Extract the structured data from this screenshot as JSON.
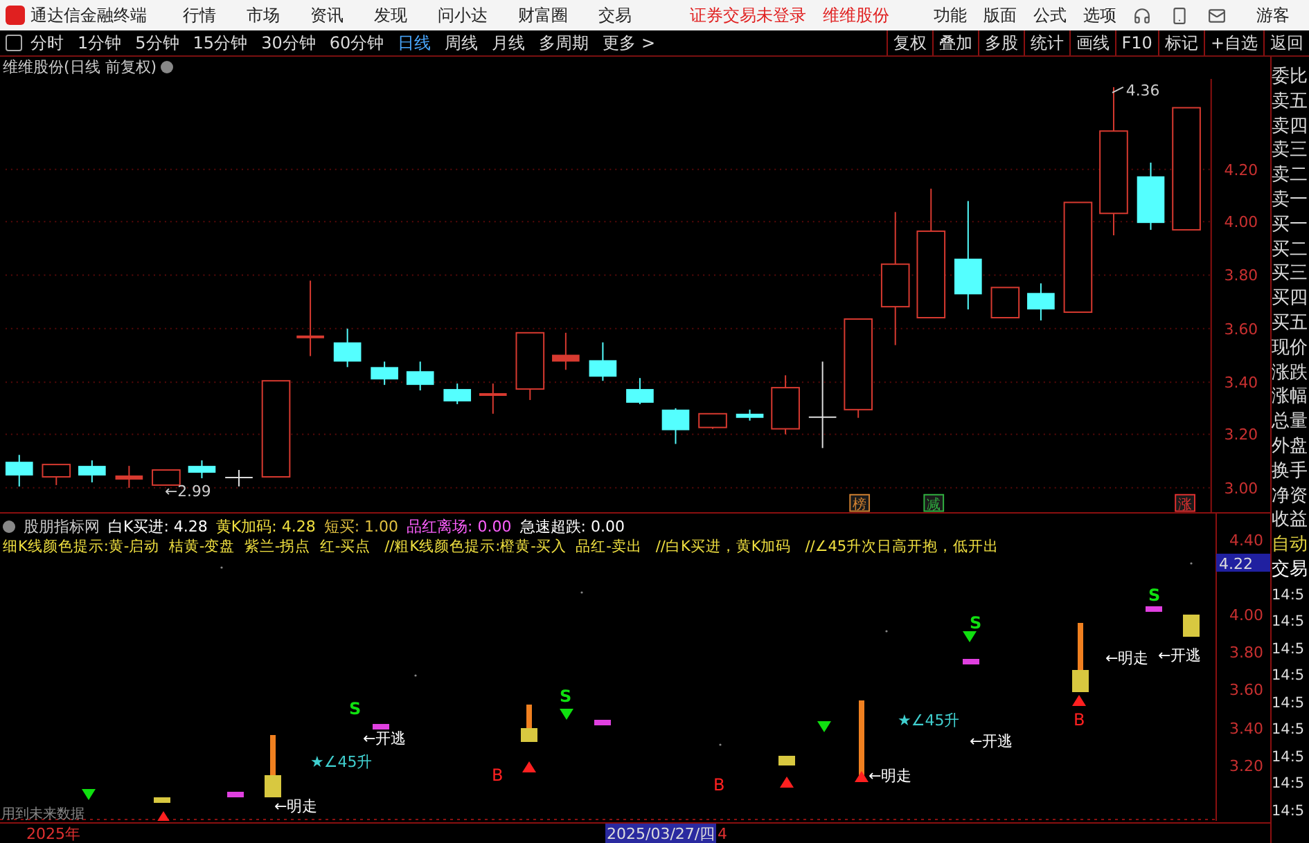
{
  "menu_bar": {
    "app_title": "通达信金融终端",
    "menus": [
      "行情",
      "市场",
      "资讯",
      "发现",
      "问小达",
      "财富圈",
      "交易"
    ],
    "status_notice": "证券交易未登录",
    "stock_name": "维维股份",
    "tools": [
      "功能",
      "版面",
      "公式",
      "选项"
    ],
    "user": "游客"
  },
  "period_bar": {
    "periods": [
      {
        "label": "分时",
        "selected": false
      },
      {
        "label": "1分钟",
        "selected": false
      },
      {
        "label": "5分钟",
        "selected": false
      },
      {
        "label": "15分钟",
        "selected": false
      },
      {
        "label": "30分钟",
        "selected": false
      },
      {
        "label": "60分钟",
        "selected": false
      },
      {
        "label": "日线",
        "selected": true
      },
      {
        "label": "周线",
        "selected": false
      },
      {
        "label": "月线",
        "selected": false
      },
      {
        "label": "多周期",
        "selected": false
      },
      {
        "label": "更多 >",
        "selected": false
      }
    ],
    "actions": [
      "复权",
      "叠加",
      "多股",
      "统计",
      "画线",
      "F10",
      "标记",
      "+自选",
      "返回"
    ]
  },
  "chart": {
    "title": "维维股份(日线 前复权)",
    "price_labels": [
      "4.20",
      "4.00",
      "3.80",
      "3.60",
      "3.40",
      "3.20",
      "3.00"
    ],
    "high_label": "4.36",
    "low_label": "←2.99",
    "signal_tags": [
      {
        "text": "榜",
        "color": "#d08030"
      },
      {
        "text": "减",
        "color": "#30b040"
      },
      {
        "text": "涨",
        "color": "#e03030"
      }
    ]
  },
  "indicator": {
    "name": "股朋指标网",
    "values": [
      {
        "label": "白K买进: 4.28",
        "color": "#ffffff"
      },
      {
        "label": "黄K加码: 4.28",
        "color": "#f0e040"
      },
      {
        "label": "短买: 1.00",
        "color": "#e0c040"
      },
      {
        "label": "品红离场: 0.00",
        "color": "#ff60ff"
      },
      {
        "label": "急速超跌: 0.00",
        "color": "#ffffff"
      }
    ],
    "legend": "细K线颜色提示:黄-启动  桔黄-变盘  紫兰-拐点  红-买点   //粗K线颜色提示:橙黄-买入  品红-卖出   //白K买进，黄K加码   //∠45升次日高开抱，低开出",
    "price_labels": [
      {
        "text": "4.40",
        "selected": false
      },
      {
        "text": "4.22",
        "selected": true
      },
      {
        "text": "4.00",
        "selected": false
      },
      {
        "text": "3.80",
        "selected": false
      },
      {
        "text": "3.60",
        "selected": false
      },
      {
        "text": "3.40",
        "selected": false
      },
      {
        "text": "3.20",
        "selected": false
      }
    ],
    "signals": [
      {
        "kind": "sell",
        "text": "S"
      },
      {
        "kind": "note",
        "text": "←开逃"
      },
      {
        "kind": "star",
        "text": "★∠45升"
      },
      {
        "kind": "note",
        "text": "←明走"
      },
      {
        "kind": "buy",
        "text": "B"
      },
      {
        "kind": "sell",
        "text": "S"
      },
      {
        "kind": "buy",
        "text": "B"
      },
      {
        "kind": "note",
        "text": "←明走"
      },
      {
        "kind": "star",
        "text": "★∠45升"
      },
      {
        "kind": "sell",
        "text": "S"
      },
      {
        "kind": "note",
        "text": "←开逃"
      },
      {
        "kind": "buy",
        "text": "B"
      },
      {
        "kind": "note",
        "text": "←明走"
      },
      {
        "kind": "sell",
        "text": "S"
      },
      {
        "kind": "note",
        "text": "←开逃"
      }
    ],
    "future_data_note": "用到未来数据"
  },
  "time_axis": [
    {
      "text": "2025年",
      "selected": false
    },
    {
      "text": "2025/03/27/四",
      "selected": true
    },
    {
      "text": "4",
      "selected": false
    }
  ],
  "side_panel": {
    "quote_labels": [
      "委比",
      "卖五",
      "卖四",
      "卖三",
      "卖二",
      "卖一",
      "买一",
      "买二",
      "买三",
      "买四",
      "买五",
      "现价",
      "涨跌",
      "涨幅",
      "总量",
      "外盘",
      "换手",
      "净资",
      "收益"
    ],
    "mode_labels": [
      {
        "text": "自动",
        "color": "#e0d040"
      },
      {
        "text": "交易",
        "color": "#ffffff"
      }
    ],
    "times": [
      "14:5",
      "14:5",
      "14:5",
      "14:5",
      "14:5",
      "14:5",
      "14:5",
      "14:5",
      "14:5"
    ]
  }
}
